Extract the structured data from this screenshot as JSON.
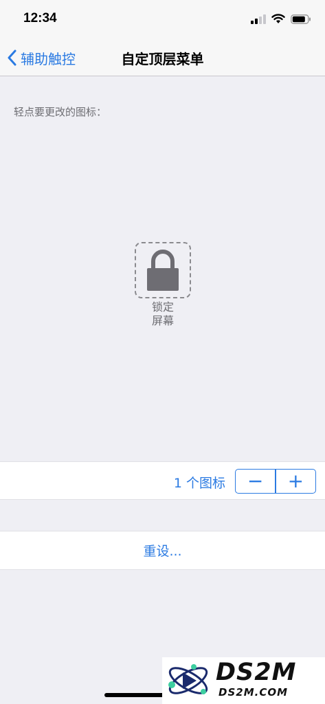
{
  "status_bar": {
    "time": "12:34",
    "icons": [
      "cellular-signal-icon",
      "wifi-icon",
      "battery-icon"
    ]
  },
  "nav": {
    "back_label": "辅助触控",
    "title": "自定顶层菜单"
  },
  "hint": "轻点要更改的图标：",
  "slot": {
    "icon": "lock-icon",
    "label_line1": "锁定",
    "label_line2": "屏幕"
  },
  "count": {
    "label": "1 个图标",
    "minus": "−",
    "plus": "+"
  },
  "reset": {
    "label": "重设..."
  },
  "watermark": {
    "big": "DS2M",
    "small": "DS2M.COM"
  },
  "colors": {
    "accent": "#2a7ae2",
    "background": "#efeff4",
    "lock": "#6e6d73"
  }
}
